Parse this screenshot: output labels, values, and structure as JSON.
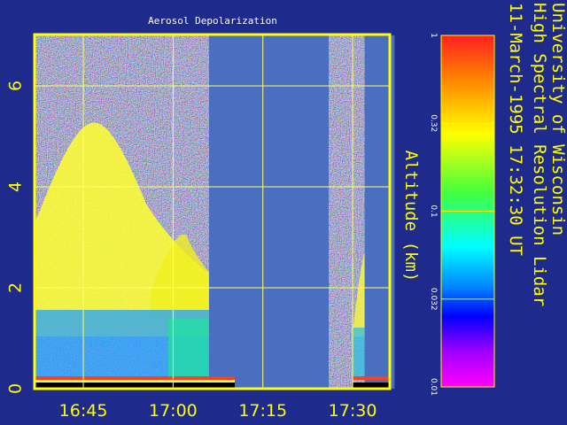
{
  "chart_data": {
    "type": "heatmap",
    "title": "Aerosol Depolarization",
    "ylabel": "Altitude (km)",
    "xlabel": "",
    "x_tick_labels": [
      "16:45",
      "17:00",
      "17:15",
      "17:30"
    ],
    "y_ticks": [
      0,
      2,
      4,
      6
    ],
    "ylim": [
      0,
      7
    ],
    "x_range_minutes": [
      0,
      60
    ],
    "x_range_note_start": "16:37",
    "colorbar": {
      "scale": "log",
      "tick_labels": [
        "1",
        "0.32",
        "0.1",
        "0.032",
        "0.01"
      ],
      "range": [
        0.01,
        1
      ]
    },
    "grid": true,
    "data_gaps": [
      {
        "start": "17:06",
        "end": "17:26"
      },
      {
        "start": "17:32",
        "end": "17:37"
      }
    ],
    "side_title": [
      "University of Wisconsin",
      "High Spectral Resolution Lidar",
      "11-March-1995 17:32:30 UT"
    ]
  },
  "colors": {
    "background": "#1e2a8c",
    "frame": "#ffff00",
    "gap": "#4a6ec0",
    "grid": "#ffff66"
  }
}
